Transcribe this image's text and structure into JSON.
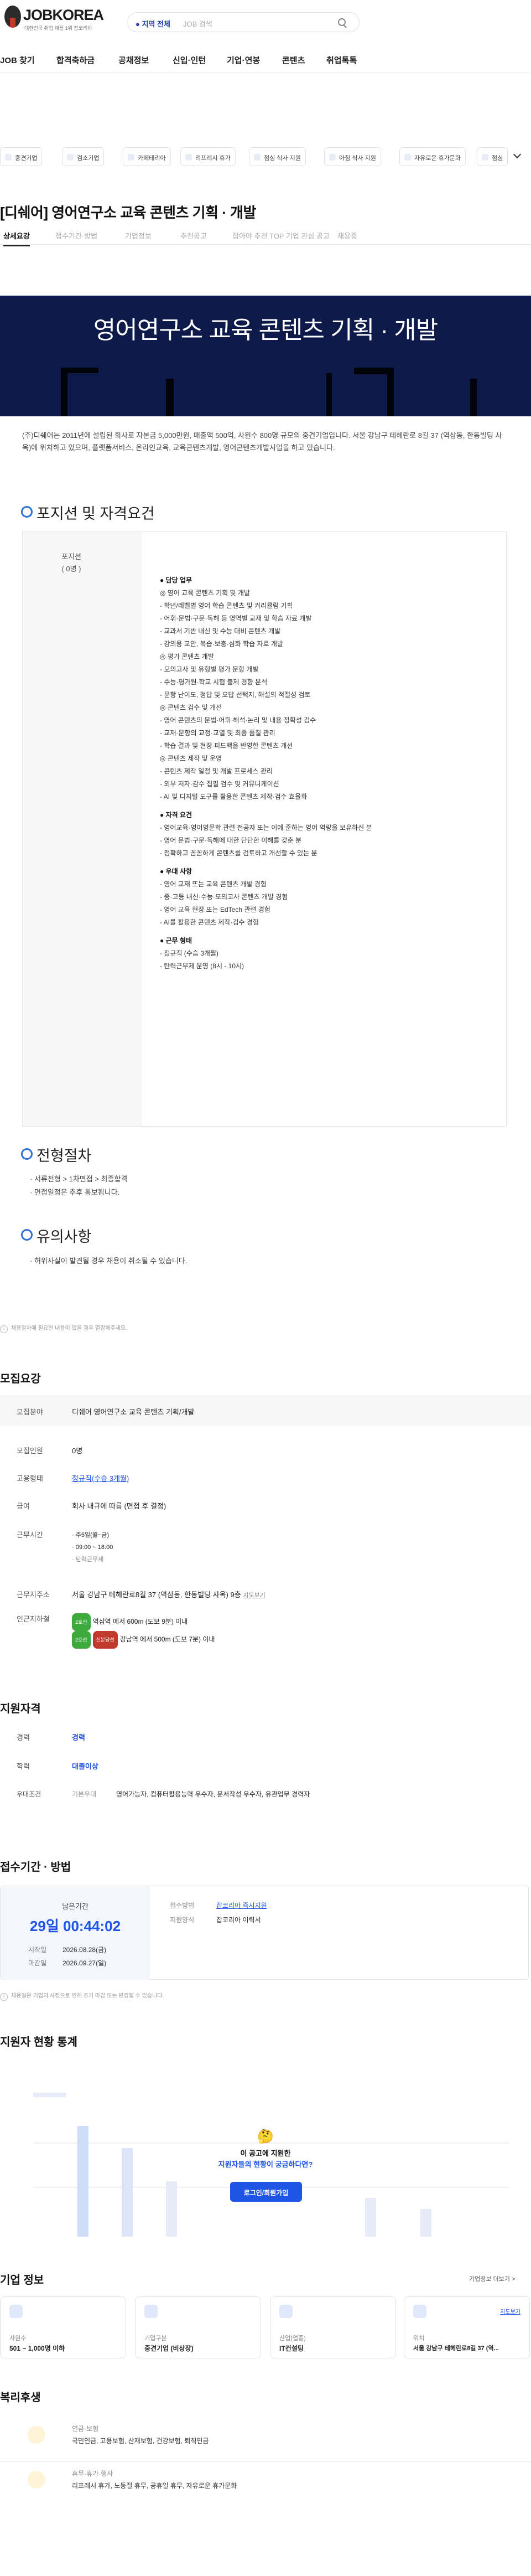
{
  "header": {
    "logo_text": "JOBKOREA",
    "logo_sub": "대한민국 취업 채용 1위 잡코리아",
    "location": "지역 전체",
    "search_placeholder": "JOB 검색"
  },
  "nav": [
    "JOB 찾기",
    "합격축하금",
    "공채정보",
    "신입·인턴",
    "기업·연봉",
    "콘텐츠",
    "취업톡톡"
  ],
  "chips": [
    "중견기업",
    "검소기업",
    "카페테리아",
    "리프레시 휴가",
    "점심 식사 지원",
    "아침 식사 지원",
    "자유로운 휴가문화",
    "점심"
  ],
  "job": {
    "title": "[디쉐어] 영어연구소 교육 콘텐츠 기획 · 개발",
    "tabs": [
      "상세요강",
      "접수기간·방법",
      "기업정보",
      "추천공고",
      "잡아야 추천 TOP 기업 관심 공고",
      "채용중"
    ],
    "banner_title": "영어연구소 교육 콘텐츠 기획 · 개발",
    "intro": "(주)디쉐어는 2011년에 설립된 회사로 자본금 5,000만원, 매출액 500억, 사원수 800명 규모의 중견기업입니다. 서울 강남구 테헤란로 8길 37 (역삼동, 한동빌딩 사옥)에 위치하고 있으며, 플랫폼서비스, 온라인교육, 교육콘텐츠개발, 영어콘텐츠개발사업을 하고 있습니다."
  },
  "positions": {
    "heading": "포지션 및 자격요건",
    "left_title": "포지션",
    "left_count": "( 0명 )",
    "lines": [
      {
        "h": true,
        "t": "● 담당 업무"
      },
      {
        "t": "◎ 영어 교육 콘텐츠 기획 및 개발"
      },
      {
        "t": "- 학년/레벨별 영어 학습 콘텐츠 및 커리큘럼 기획"
      },
      {
        "t": "- 어휘·문법·구문·독해 등 영역별 교재 및 학습 자료 개발"
      },
      {
        "t": "- 교과서 기반 내신 및 수능 대비 콘텐츠 개발"
      },
      {
        "t": "- 강의용 교안, 복습·보충·심화 학습 자료 개발"
      },
      {
        "t": "◎ 평가 콘텐츠 개발"
      },
      {
        "t": "- 모의고사 및 유형별 평가 문항 개발"
      },
      {
        "t": "- 수능·평가원·학교 시험 출제 경향 분석"
      },
      {
        "t": "- 문항 난이도, 정답 및 오답 선택지, 해설의 적절성 검토"
      },
      {
        "t": "◎ 콘텐츠 검수 및 개선"
      },
      {
        "t": "- 영어 콘텐츠의 문법·어휘·해석·논리 및 내용 정확성 검수"
      },
      {
        "t": "- 교재·문항의 교정·교열 및 최종 품질 관리"
      },
      {
        "t": "- 학습 결과 및 현장 피드백을 반영한 콘텐츠 개선"
      },
      {
        "t": "◎ 콘텐츠 제작 및 운영"
      },
      {
        "t": "- 콘텐츠 제작 일정 및 개발 프로세스 관리"
      },
      {
        "t": "- 외부 저자·감수 집필 검수 및 커뮤니케이션"
      },
      {
        "t": "- AI 및 디지털 도구를 활용한 콘텐츠 제작·검수 효율화"
      },
      {
        "h": true,
        "t": "● 자격 요건"
      },
      {
        "t": "- 영어교육·영어영문학 관련 전공자 또는 이에 준하는 영어 역량을 보유하신 분"
      },
      {
        "t": "- 영어 문법·구문·독해에 대한 탄탄한 이해를 갖춘 분"
      },
      {
        "t": "- 정확하고 꼼꼼하게 콘텐츠를 검토하고 개선할 수 있는 분"
      },
      {
        "h": true,
        "t": "● 우대 사항"
      },
      {
        "t": "- 영어 교재 또는 교육 콘텐츠 개발 경험"
      },
      {
        "t": "- 중·고등 내신·수능·모의고사 콘텐츠 개발 경험"
      },
      {
        "t": "- 영어 교육 현장 또는 EdTech 관련 경험"
      },
      {
        "t": "- AI를 활용한 콘텐츠 제작·검수 경험"
      },
      {
        "h": true,
        "t": "● 근무 형태"
      },
      {
        "t": "- 정규직 (수습 3개월)"
      },
      {
        "t": "- 탄력근무제 운영 (8시 - 10시)"
      }
    ]
  },
  "process": {
    "heading": "전형절차",
    "lines": [
      "· 서류전형 > 1차면접 > 최종합격",
      "· 면접일정은 추후 통보됩니다."
    ]
  },
  "notes": {
    "heading": "유의사항",
    "lines": [
      "· 허위사실이 발견될 경우 채용이 취소될 수 있습니다."
    ]
  },
  "detail_footnote": "채용절차에 필요한 내용이 있을 경우 열람해주세요.",
  "recruit": {
    "heading": "모집요강",
    "rows": [
      {
        "k": "모집분야",
        "v": "디쉐어 영어연구소 교육 콘텐츠 기획/개발"
      },
      {
        "k": "모집인원",
        "v": "0명"
      },
      {
        "k": "고용형태",
        "v": "정규직(수습 3개월)"
      },
      {
        "k": "급여",
        "v": "회사 내규에 따름 (면접 후 결정)"
      },
      {
        "k": "근무시간",
        "v": "· 주5일(월~금)"
      },
      {
        "k": "",
        "v": "· 09:00 ~ 18:00"
      },
      {
        "k": "",
        "v": "· 탄력근무제"
      },
      {
        "k": "근무지주소",
        "v": "서울 강남구 테헤란로8길 37 (역삼동, 한동빌딩 사옥) 9층"
      },
      {
        "k": "인근지하철",
        "v": "역삼역 에서 600m (도보 9분) 이내"
      },
      {
        "k": "",
        "v": "강남역 에서 500m (도보 7분) 이내"
      }
    ],
    "map_label": "지도보기",
    "pill_line2": "2호선",
    "pill_sinbundang": "신분당선"
  },
  "qual": {
    "heading": "지원자격",
    "rows": [
      {
        "k": "경력",
        "v": "경력"
      },
      {
        "k": "학력",
        "v": "대졸이상"
      },
      {
        "k": "우대조건",
        "tag": "기본우대",
        "v": "영어가능자, 컴퓨터활용능력 우수자, 문서작성 우수자, 유관업무 경력자"
      }
    ]
  },
  "apply": {
    "heading": "접수기간 · 방법",
    "remain_label": "남은기간",
    "remain": "29일 00:44:02",
    "start_label": "시작일",
    "start": "2026.08.28(금)",
    "end_label": "마감일",
    "end": "2026.09.27(일)",
    "method_label": "접수방법",
    "method": "잡코리아 즉시지원",
    "form_label": "지원양식",
    "form": "잡코리아 이력서",
    "footnote": "채용일은 기업의 사정으로 인해 조기 마감 또는 변경될 수 있습니다."
  },
  "stats": {
    "heading": "지원자 현황 통계",
    "q1": "이 공고에 지원한",
    "q2": "지원자들의 현황이 궁금하다면?",
    "button": "로그인/회원가입"
  },
  "company": {
    "heading": "기업 정보",
    "more": "기업정보 더보기 >",
    "cards": [
      {
        "l": "사원수",
        "v": "501 ~ 1,000명 이하"
      },
      {
        "l": "기업구분",
        "v": "중견기업 (비상장)"
      },
      {
        "l": "산업(업종)",
        "v": "IT컨설팅"
      },
      {
        "l": "위치",
        "v": "서울 강남구 테헤란로8길 37 (역..."
      }
    ],
    "map_label": "지도보기"
  },
  "benefits": {
    "heading": "복리후생",
    "items": [
      {
        "t": "연금·보험",
        "d": "국민연금, 고용보험, 산재보험, 건강보험, 퇴직연금"
      },
      {
        "t": "휴무·휴가·행사",
        "d": "리프레시 휴가, 노동절 휴무, 공휴일 휴무, 자유로운 휴가문화"
      }
    ]
  }
}
